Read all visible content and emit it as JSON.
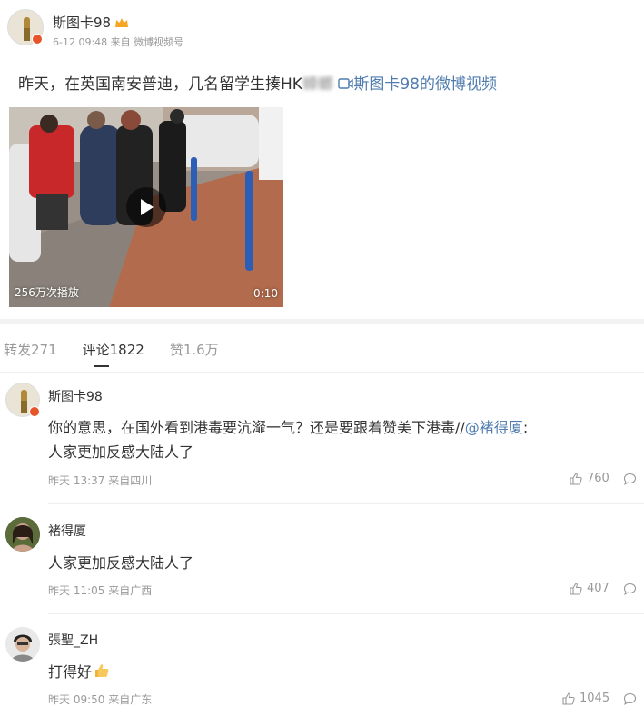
{
  "post": {
    "author": "斯图卡98",
    "crown_icon": "crown-icon",
    "meta_time": "6-12 09:48",
    "meta_from": "来自",
    "meta_source": "微博视频号",
    "text": "昨天，在英国南安普迪，几名留学生揍HK",
    "blurred_text": "蟑螂",
    "video_link": "斯图卡98的微博视频",
    "video": {
      "plays": "256万次播放",
      "duration": "0:10"
    }
  },
  "tabs": [
    {
      "label": "转发271"
    },
    {
      "label": "评论1822"
    },
    {
      "label": "赞1.6万"
    }
  ],
  "comments": [
    {
      "user": "斯图卡98",
      "text": "你的意思，在国外看到港毒要沆瀣一气？还是要跟着赞美下港毒//",
      "mention": "@褚得厦",
      "text2": ":",
      "quote": "人家更加反感大陆人了",
      "meta": "昨天 13:37 来自四川",
      "likes": "760"
    },
    {
      "user": "褚得厦",
      "text": "人家更加反感大陆人了",
      "meta": "昨天 11:05 来自广西",
      "likes": "407"
    },
    {
      "user": "張聖_ZH",
      "text": "打得好",
      "meta": "昨天 09:50 来自广东",
      "likes": "1045"
    }
  ],
  "colors": {
    "link": "#507daf",
    "active_tab_underline": "#333333",
    "crown": "#f5a623",
    "verified_badge": "#e8542a"
  }
}
